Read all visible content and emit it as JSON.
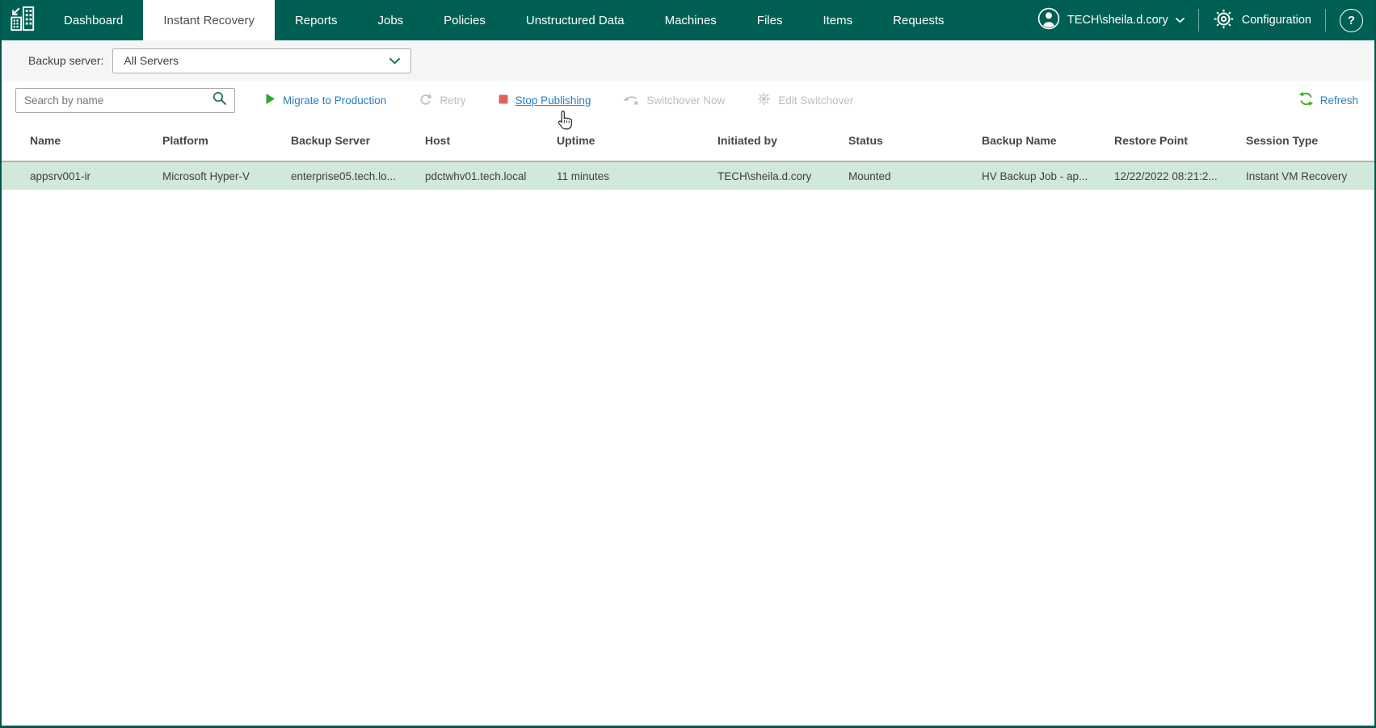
{
  "colors": {
    "nav_background": "#005F53",
    "active_tab_text": "#47504F",
    "link_blue": "#2B7CBE",
    "disabled_gray": "#BDBDBD",
    "play_green": "#2EA632",
    "stop_red": "#E2605C",
    "refresh_green": "#3FAE2A",
    "icon_dark_green": "#1D6B52",
    "row_highlight": "#D0E9DA",
    "header_border_gray": "#B3B3B3",
    "filter_bar_background": "#F5F5F5",
    "page_border_green": "#00564C"
  },
  "nav": {
    "logo_icon": "veeam-enterprise-manager-logo-icon",
    "tabs": [
      {
        "label": "Dashboard",
        "active": false
      },
      {
        "label": "Instant Recovery",
        "active": true
      },
      {
        "label": "Reports",
        "active": false
      },
      {
        "label": "Jobs",
        "active": false
      },
      {
        "label": "Policies",
        "active": false
      },
      {
        "label": "Unstructured Data",
        "active": false
      },
      {
        "label": "Machines",
        "active": false
      },
      {
        "label": "Files",
        "active": false
      },
      {
        "label": "Items",
        "active": false
      },
      {
        "label": "Requests",
        "active": false
      }
    ],
    "user": {
      "icon": "user-avatar-icon",
      "name": "TECH\\sheila.d.cory",
      "chevron": "chevron-down-icon"
    },
    "configuration": {
      "icon": "gear-icon",
      "label": "Configuration"
    },
    "help": {
      "icon": "help-icon",
      "label": "?"
    }
  },
  "filter_bar": {
    "label": "Backup server:",
    "selected_value": "All Servers",
    "chevron": "chevron-down-icon"
  },
  "toolbar": {
    "search": {
      "placeholder": "Search by name",
      "value": "",
      "icon": "search-icon"
    },
    "actions": [
      {
        "label": "Migrate to Production",
        "icon": "play-icon",
        "enabled": true,
        "hovered": false
      },
      {
        "label": "Retry",
        "icon": "retry-icon",
        "enabled": false,
        "hovered": false
      },
      {
        "label": "Stop Publishing",
        "icon": "stop-icon",
        "enabled": true,
        "hovered": true
      },
      {
        "label": "Switchover Now",
        "icon": "switchover-icon",
        "enabled": false,
        "hovered": false
      },
      {
        "label": "Edit Switchover",
        "icon": "edit-switchover-icon",
        "enabled": false,
        "hovered": false
      }
    ],
    "refresh": {
      "label": "Refresh",
      "icon": "refresh-icon"
    }
  },
  "table": {
    "columns": [
      "Name",
      "Platform",
      "Backup Server",
      "Host",
      "Uptime",
      "Initiated by",
      "Status",
      "Backup Name",
      "Restore Point",
      "Session Type"
    ],
    "rows": [
      {
        "name": "appsrv001-ir",
        "platform": "Microsoft Hyper-V",
        "backup_server": "enterprise05.tech.lo...",
        "host": "pdctwhv01.tech.local",
        "uptime": "11 minutes",
        "initiated_by": "TECH\\sheila.d.cory",
        "status": "Mounted",
        "backup_name": "HV Backup Job - ap...",
        "restore_point": "12/22/2022 08:21:2...",
        "session_type": "Instant VM Recovery"
      }
    ],
    "selected_row_index": 0
  },
  "cursor": {
    "type": "hand-pointer",
    "near": "Stop Publishing"
  }
}
